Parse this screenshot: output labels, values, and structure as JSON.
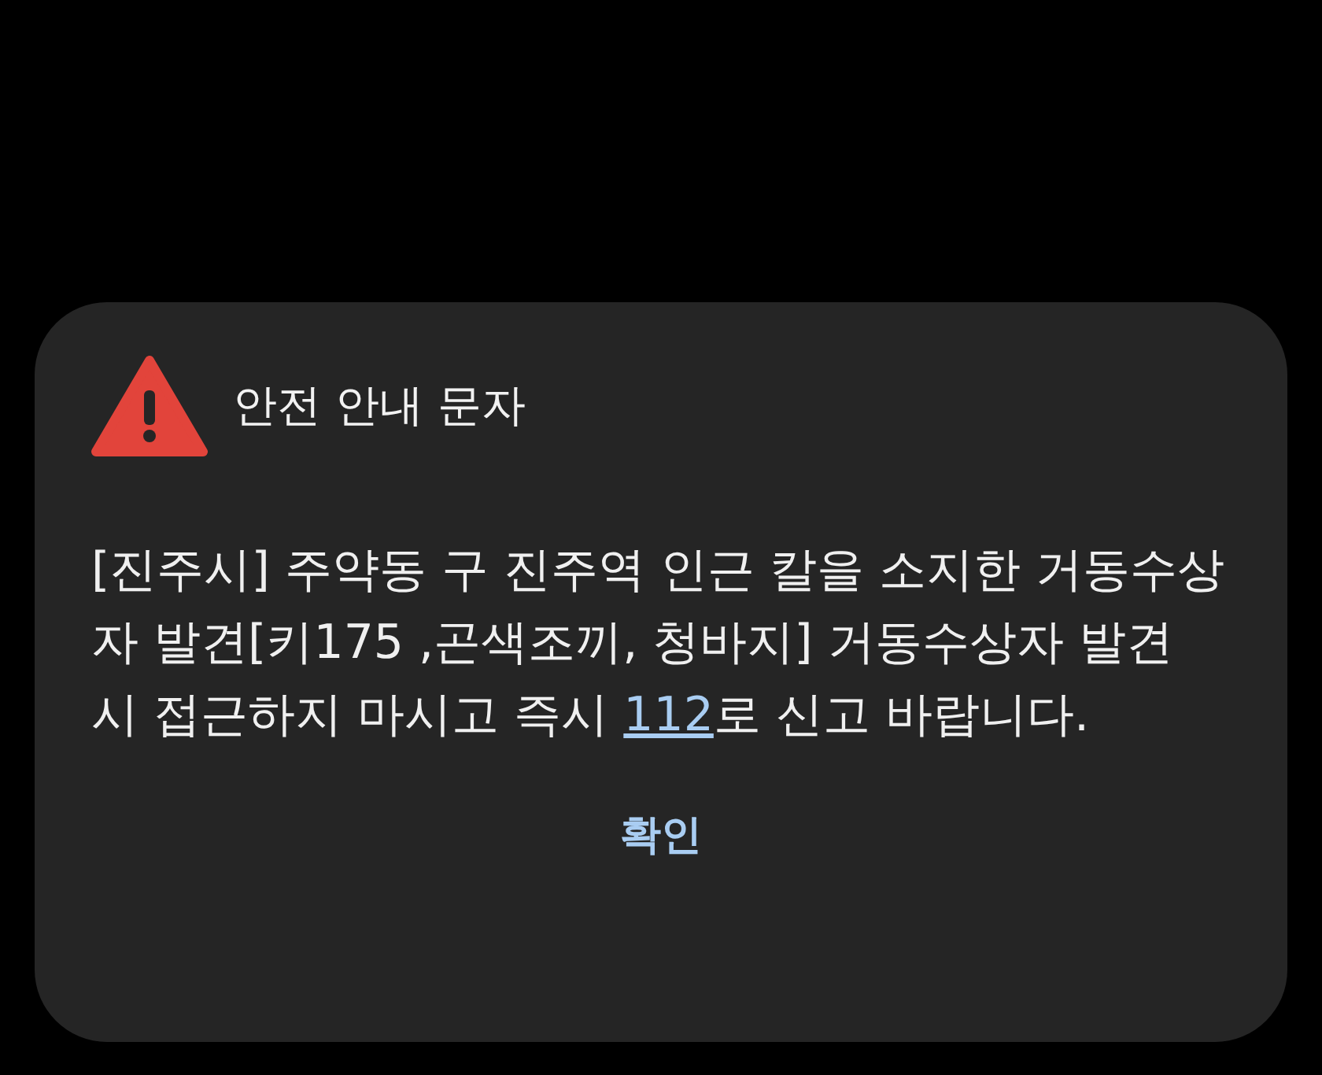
{
  "dialog": {
    "title": "안전 안내 문자",
    "message": {
      "before": "[진주시] 주약동 구 진주역 인근 칼을 소지한 거동수상자 발견[키175 ,곤색조끼, 청바지] 거동수상자 발견 시 접근하지 마시고 즉시 ",
      "link": "112",
      "after": "로 신고 바랍니다."
    },
    "buttons": [
      "확인"
    ]
  }
}
